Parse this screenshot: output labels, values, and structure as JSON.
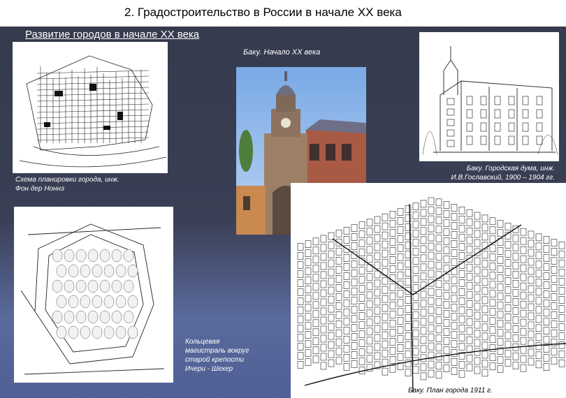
{
  "slide": {
    "title": "2. Градостроительство в России в начале  XX века",
    "subtitle": "Развитие городов в начале XX века"
  },
  "captions": {
    "baku_early": "Баку. Начало XX века",
    "scheme_line1": "Схема планировки города, инж.",
    "scheme_line2": "Фон дер Ноннэ",
    "duma_line1": "Баку. Городская дума, инж.",
    "duma_line2": "И.В.Гославский,  1900 – 1904 гг.",
    "ring_line1": "Кольцевая",
    "ring_line2": "магистраль вокруг",
    "ring_line3": "старой крепости",
    "ring_line4": "Ичери - Шехер",
    "plan_1911": "Баку. План города 1911 г."
  },
  "colors": {
    "background": "#383c4e",
    "title_bar": "#ffffff",
    "caption_text": "#ffffff"
  }
}
